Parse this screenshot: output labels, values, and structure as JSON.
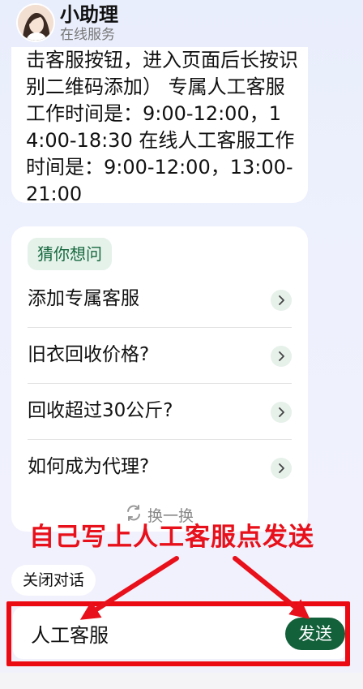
{
  "header": {
    "title": "小助理",
    "subtitle": "在线服务",
    "avatar_icon": "avatar-photo"
  },
  "message": {
    "text": "击客服按钮，进入页面后长按识别二维码添加） 专属人工客服工作时间是：9:00-12:00，14:00-18:30 在线人工客服工作时间是：9:00-12:00，13:00-21:00"
  },
  "suggestions": {
    "badge": "猜你想问",
    "items": [
      {
        "label": "添加专属客服"
      },
      {
        "label": "旧衣回收价格?"
      },
      {
        "label": "回收超过30公斤?"
      },
      {
        "label": "如何成为代理?"
      }
    ],
    "refresh_label": "换一换",
    "refresh_icon": "refresh-icon"
  },
  "annotation": {
    "text": "自己写上人工客服点发送",
    "color": "#e8101a"
  },
  "close_chip": {
    "label": "关闭对话"
  },
  "input": {
    "value": "人工客服",
    "send_label": "发送"
  },
  "colors": {
    "brand_green": "#13613b",
    "badge_bg": "#e5f2ea",
    "highlight_red": "#ec0a12"
  }
}
